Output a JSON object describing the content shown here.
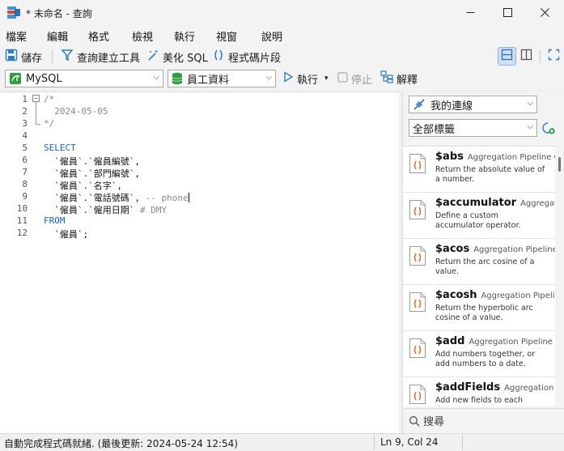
{
  "window": {
    "title": "* 未命名 - 查詢",
    "minimize_label": "—",
    "maximize_label": "☐",
    "close_label": "✕"
  },
  "menu": [
    "檔案",
    "編輯",
    "格式",
    "檢視",
    "執行",
    "視窗",
    "說明"
  ],
  "toolbar": {
    "save": "儲存",
    "query_builder": "查詢建立工具",
    "beautify": "美化 SQL",
    "snippet": "程式碼片段"
  },
  "connection": {
    "db_type": "MySQL",
    "database": "員工資料",
    "run": "執行",
    "stop": "停止",
    "explain": "解釋"
  },
  "editor": {
    "line_numbers": [
      "1",
      "2",
      "3",
      "4",
      "5",
      "6",
      "7",
      "8",
      "9",
      "10",
      "11",
      "12"
    ],
    "lines": [
      [
        {
          "t": "/*",
          "c": "cm"
        }
      ],
      [
        {
          "t": "  2024-05-05",
          "c": "cm"
        }
      ],
      [
        {
          "t": "*/",
          "c": "cm"
        }
      ],
      [],
      [
        {
          "t": "SELECT",
          "c": "kw"
        }
      ],
      [
        {
          "t": "  `僱員`.`僱員編號`,",
          "c": ""
        }
      ],
      [
        {
          "t": "  `僱員`.`部門編號`,",
          "c": ""
        }
      ],
      [
        {
          "t": "  `僱員`.`名字`,",
          "c": ""
        }
      ],
      [
        {
          "t": "  `僱員`.`電話號碼`,",
          "c": ""
        },
        {
          "t": " -- phone",
          "c": "cm"
        }
      ],
      [
        {
          "t": "  `僱員`.`僱用日期`",
          "c": ""
        },
        {
          "t": " # DMY",
          "c": "cm"
        }
      ],
      [
        {
          "t": "FROM",
          "c": "kw"
        }
      ],
      [
        {
          "t": "  `僱員`;",
          "c": ""
        }
      ]
    ]
  },
  "panel": {
    "connection_filter": "我的連線",
    "tag_filter": "全部標籤",
    "search_placeholder": "搜尋",
    "snippets": [
      {
        "name": "$abs",
        "category": "Aggregation Pipeline Operator",
        "desc": "Return the absolute value of a number."
      },
      {
        "name": "$accumulator",
        "category": "Aggregation Pipeline Operator",
        "desc": "Define a custom accumulator operator."
      },
      {
        "name": "$acos",
        "category": "Aggregation Pipeline Operator",
        "desc": "Return the arc cosine of a value."
      },
      {
        "name": "$acosh",
        "category": "Aggregation Pipeline Operator",
        "desc": "Return the hyperbolic arc cosine of a value."
      },
      {
        "name": "$add",
        "category": "Aggregation Pipeline Operator",
        "desc": "Add numbers together, or add numbers to a date."
      },
      {
        "name": "$addFields",
        "category": "Aggregation Pipeline Stage",
        "desc": "Add new fields to each documents."
      }
    ]
  },
  "status": {
    "message": "自動完成程式碼就緒. (最後更新: 2024-05-24 12:54)",
    "cursor": "Ln 9, Col 24"
  }
}
